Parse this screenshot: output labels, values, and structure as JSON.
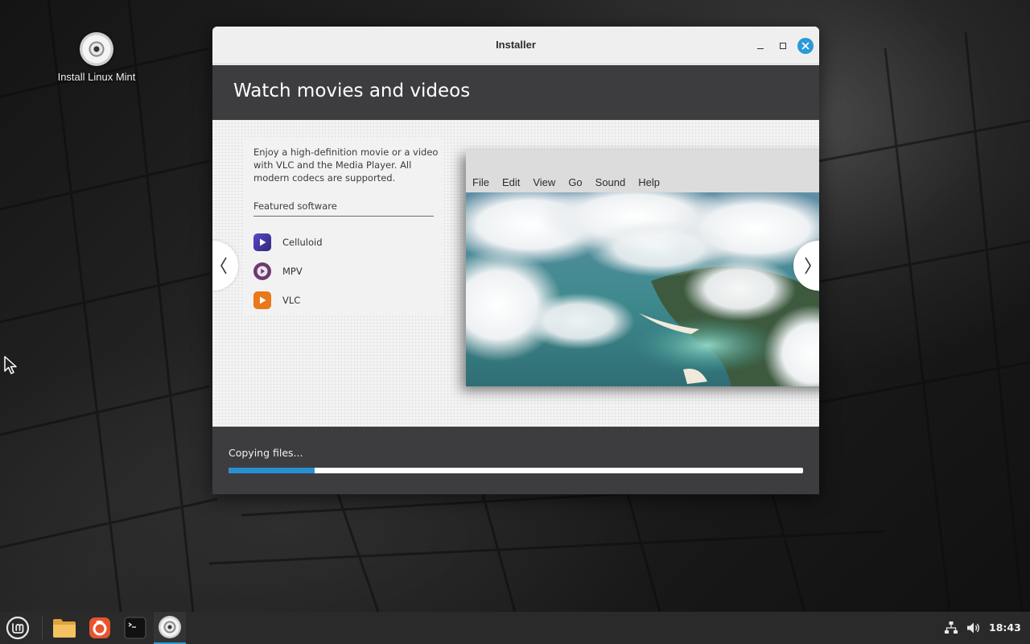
{
  "desktop": {
    "icon_label": "Install Linux Mint"
  },
  "window": {
    "title": "Installer",
    "header_title": "Watch movies and videos",
    "description": "Enjoy a high-definition movie or a video with VLC and the Media Player. All modern codecs are supported.",
    "featured_heading": "Featured software",
    "featured_apps": [
      {
        "name": "Celluloid",
        "icon": "celluloid-icon",
        "color": "#4a3aa8"
      },
      {
        "name": "MPV",
        "icon": "mpv-icon",
        "color": "#6b3a6e"
      },
      {
        "name": "VLC",
        "icon": "vlc-icon",
        "color": "#e8781a"
      }
    ],
    "player_menu": [
      "File",
      "Edit",
      "View",
      "Go",
      "Sound",
      "Help"
    ],
    "status": "Copying files...",
    "progress": 0.15
  },
  "taskbar": {
    "apps": [
      "mint-menu-icon",
      "file-manager-icon",
      "firefox-icon",
      "terminal-icon",
      "installer-icon"
    ],
    "time": "18:43",
    "accent": "#2a9ad8"
  }
}
